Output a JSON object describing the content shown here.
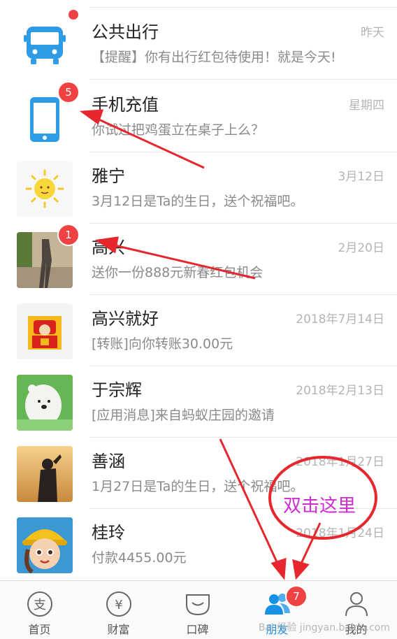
{
  "conversations": [
    {
      "name": "公共出行",
      "message": "【提醒】你有出行红包待使用！就是今天!",
      "time": "昨天",
      "icon": "bus-icon"
    },
    {
      "name": "手机充值",
      "message": "你试过把鸡蛋立在桌子上么？",
      "time": "星期四",
      "icon": "phone-icon",
      "badge": "5"
    },
    {
      "name": "雅宁",
      "message": "3月12日是Ta的生日，送个祝福吧。",
      "time": "3月12日",
      "icon": "sun-avatar"
    },
    {
      "name": "高兴",
      "message": "送你一份888元新春红包机会",
      "time": "2月20日",
      "icon": "shadow-photo-avatar",
      "badge": "1"
    },
    {
      "name": "高兴就好",
      "message": "[转账]向你转账30.00元",
      "time": "2018年7月14日",
      "icon": "fortune-god-avatar"
    },
    {
      "name": "于宗辉",
      "message": "[应用消息]来自蚂蚁庄园的邀请",
      "time": "2018年2月13日",
      "icon": "bear-avatar"
    },
    {
      "name": "善涵",
      "message": "1月27日是Ta的生日，送个祝福吧。",
      "time": "2018年1月27日",
      "icon": "silhouette-avatar"
    },
    {
      "name": "桂玲",
      "message": "付款4455.00元",
      "time": "2018年1月24日",
      "icon": "game-character-avatar"
    }
  ],
  "tabs": [
    {
      "label": "首页",
      "icon": "home-icon"
    },
    {
      "label": "财富",
      "icon": "wealth-icon"
    },
    {
      "label": "口碑",
      "icon": "koubei-icon"
    },
    {
      "label": "朋友",
      "icon": "friends-icon",
      "active": true,
      "badge": "7"
    },
    {
      "label": "我的",
      "icon": "profile-icon"
    }
  ],
  "annotation": {
    "text": "双击这里"
  },
  "watermark": {
    "text": "Bai 经验 jingyan.baidu.com"
  },
  "colors": {
    "badge": "#f04242",
    "active_tab": "#1592e8",
    "annotation_arrow": "#e8262d",
    "annotation_text": "#d02bd0"
  }
}
